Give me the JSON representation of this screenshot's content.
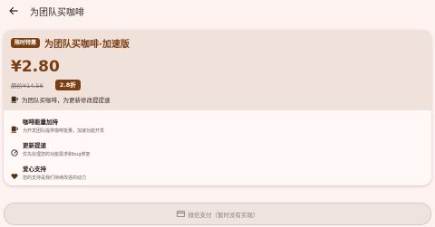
{
  "header": {
    "title": "为团队买咖啡"
  },
  "card": {
    "badge": "限时特惠",
    "product_name": "为团队买咖啡·加速版",
    "price": "¥2.80",
    "original_price": "原价¥14.56",
    "discount": "2.8折",
    "slogan": "为团队买咖啡，为更新修改提提速"
  },
  "features": [
    {
      "icon": "coffee-cup-icon",
      "title": "咖啡能量加持",
      "desc": "为开发团队提供咖啡能量，加速功能开发"
    },
    {
      "icon": "speedometer-icon",
      "title": "更新提速",
      "desc": "优先处理您的功能需求和bug修复"
    },
    {
      "icon": "heart-icon",
      "title": "爱心支持",
      "desc": "您的支持是我们持续改进的动力"
    }
  ],
  "pay_button": {
    "label": "微信支付（暂时没有实现）",
    "icon": "credit-card-icon"
  },
  "colors": {
    "accent": "#7a3e12",
    "background": "#fdf2ef",
    "card_top": "#f0e1db"
  }
}
